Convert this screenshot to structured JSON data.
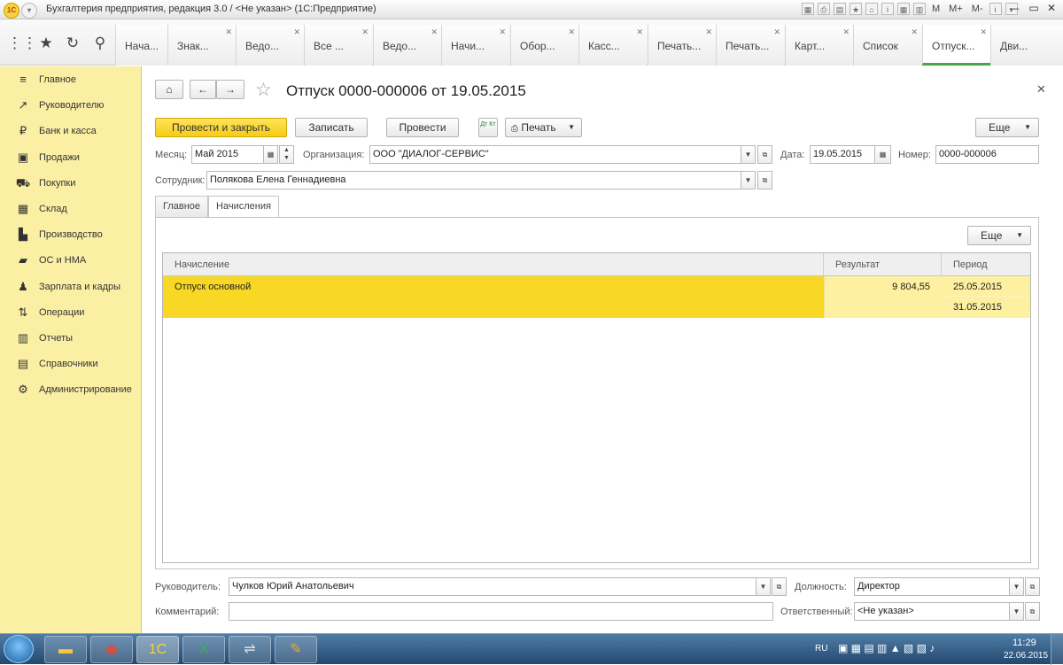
{
  "window": {
    "title": "Бухгалтерия предприятия, редакция 3.0 / <Не указан>  (1С:Предприятие)",
    "toolbar_texts": [
      "M",
      "M+",
      "M-"
    ]
  },
  "open_tabs": [
    {
      "label": "Нача..."
    },
    {
      "label": "Знак..."
    },
    {
      "label": "Ведо..."
    },
    {
      "label": "Все ..."
    },
    {
      "label": "Ведо..."
    },
    {
      "label": "Начи..."
    },
    {
      "label": "Обор..."
    },
    {
      "label": "Касс..."
    },
    {
      "label": "Печать..."
    },
    {
      "label": "Печать..."
    },
    {
      "label": "Карт..."
    },
    {
      "label": "Список"
    },
    {
      "label": "Отпуск..."
    },
    {
      "label": "Дви..."
    }
  ],
  "active_tab_index": 12,
  "sidebar": {
    "items": [
      {
        "label": "Главное",
        "icon": "menu-icon"
      },
      {
        "label": "Руководителю",
        "icon": "trend-icon"
      },
      {
        "label": "Банк и касса",
        "icon": "coin-icon"
      },
      {
        "label": "Продажи",
        "icon": "bag-icon"
      },
      {
        "label": "Покупки",
        "icon": "cart-icon"
      },
      {
        "label": "Склад",
        "icon": "warehouse-icon"
      },
      {
        "label": "Производство",
        "icon": "factory-icon"
      },
      {
        "label": "ОС и НМА",
        "icon": "assets-icon"
      },
      {
        "label": "Зарплата и кадры",
        "icon": "people-icon"
      },
      {
        "label": "Операции",
        "icon": "operations-icon"
      },
      {
        "label": "Отчеты",
        "icon": "chart-icon"
      },
      {
        "label": "Справочники",
        "icon": "books-icon"
      },
      {
        "label": "Администрирование",
        "icon": "gear-icon"
      }
    ]
  },
  "document": {
    "title": "Отпуск 0000-000006 от 19.05.2015",
    "buttons": {
      "post_close": "Провести и закрыть",
      "save": "Записать",
      "post": "Провести",
      "print": "Печать",
      "more": "Еще",
      "dt_kt": "Дт Кт"
    },
    "fields": {
      "month_label": "Месяц:",
      "month_value": "Май 2015",
      "org_label": "Организация:",
      "org_value": "ООО \"ДИАЛОГ-СЕРВИС\"",
      "date_label": "Дата:",
      "date_value": "19.05.2015",
      "number_label": "Номер:",
      "number_value": "0000-000006",
      "employee_label": "Сотрудник:",
      "employee_value": "Полякова Елена Геннадиевна"
    },
    "tabs": [
      {
        "label": "Главное"
      },
      {
        "label": "Начисления"
      }
    ],
    "grid": {
      "more": "Еще",
      "columns": [
        "Начисление",
        "Результат",
        "Период"
      ],
      "rows": [
        {
          "accrual": "Отпуск основной",
          "result": "9 804,55",
          "period_start": "25.05.2015",
          "period_end": "31.05.2015"
        }
      ]
    },
    "footer": {
      "manager_label": "Руководитель:",
      "manager_value": "Чулков Юрий Анатольевич",
      "position_label": "Должность:",
      "position_value": "Директор",
      "comment_label": "Комментарий:",
      "comment_value": "",
      "responsible_label": "Ответственный:",
      "responsible_value": "<Не указан>"
    }
  },
  "taskbar": {
    "lang": "RU",
    "time": "11:29",
    "date": "22.06.2015"
  },
  "colors": {
    "sidebar_bg": "#fbefa4",
    "primary_button": "#f6cc17",
    "selected_row": "#f8d824",
    "selected_row_light": "#fdf0a0",
    "active_tab_underline": "#41a843"
  }
}
